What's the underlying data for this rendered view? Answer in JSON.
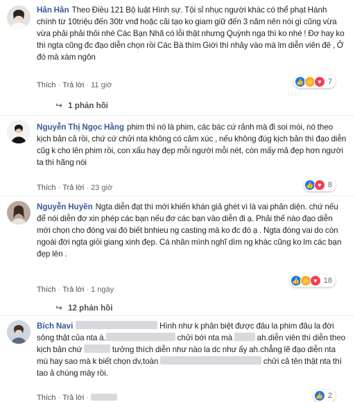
{
  "comments": [
    {
      "name": "Hân Hân",
      "text": "Theo Điều 121 Bộ luật Hình sự. Tội sỉ nhục người khác có thể phạt Hành chính từ 10triệu đến 30tr vnđ hoặc cải tạo ko giam giữ đến 3 năm nên nói gì cũng vừa vừa phải phải thôi nhé Các Bạn Nhã có lỗi thật nhưng Quỳnh nga thì ko nhé ! Đơ hay ko thì ngta cũng đc đạo diễn chọn rồi Các Bà thím Giời thì nhảy vào mà lm diễn viên đê , Ở đó mà xàm ngôn",
      "like": "Thích",
      "reply": "Trả lời",
      "time": "11 giờ",
      "reactions": "7",
      "replies": "1 phản hồi"
    },
    {
      "name": "Nguyễn Thị Ngọc Hằng",
      "text": "phim thì nó là phim, các bác cứ rảnh mà đi soi mói, nó theo kịch bản cả rồi, chứ cứ chửi nta không có cảm xúc , nếu không đúg kịch bản thì đạo diễn cũg k cho lên phim rồi, con xấu hay đẹp mỗi người mỗi nét, còn mấy mả đẹp hơn người ta thì hãng nói",
      "like": "Thích",
      "reply": "Trả lời",
      "time": "23 giờ",
      "reactions": "8"
    },
    {
      "name": "Nguyễn Huyền",
      "text": "Ngta diễn đạt thì mới khiến khán giả ghét vì là vai phản diện. chứ nếu để nói diễn đơ xin phép các bạn nếu đơ các bạn vào diễn đi ạ. Phải thế nào đạo diễn mới chọn cho đóng vai đó biết bnhieu ng casting mà ko đc đó ạ . Ngta đóng vai do còn ngoài đời ngta giỏi giang xinh đẹp. Cá nhân mình nghĩ dìm ng khác cũng ko lm các bạn đẹp lên .",
      "like": "Thích",
      "reply": "Trả lời",
      "time": "1 ngày",
      "reactions": "18",
      "replies": "12 phản hồi"
    },
    {
      "name": "Bích Navi",
      "text_1": "Hình như k phân biệt được đâu la phim đâu la đời sông thật của nta à.",
      "text_2": "chửi bới nta mà",
      "text_3": "ah.diễn viên thì diễn theo kịch bản chứ",
      "text_4": "tưởng thích diễn như nào la dc như ấy ah.chẳng lẽ đạo diễn nta mù hay sao mà k biết chọn dv,toàn",
      "text_5": "chửi cả tên thật nta thì tao ả chúng mày rồi.",
      "like": "Thích",
      "reply": "Trả lời",
      "reactions": "2"
    }
  ]
}
